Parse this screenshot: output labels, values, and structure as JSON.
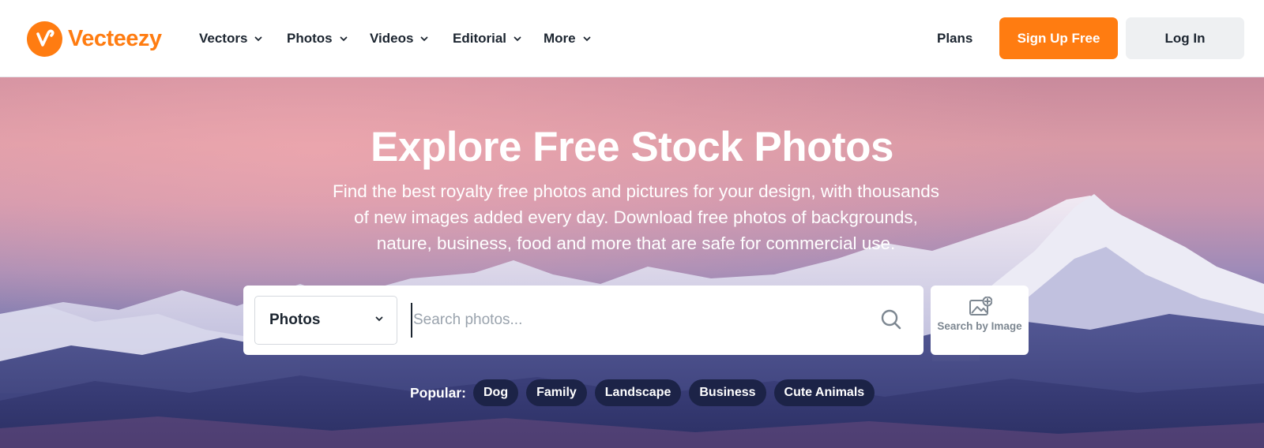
{
  "brand": {
    "name": "Vecteezy",
    "color": "#ff7c11"
  },
  "nav": {
    "items": [
      {
        "label": "Vectors"
      },
      {
        "label": "Photos"
      },
      {
        "label": "Videos"
      },
      {
        "label": "Editorial"
      },
      {
        "label": "More"
      }
    ],
    "plans_label": "Plans",
    "signup_label": "Sign Up Free",
    "login_label": "Log In"
  },
  "hero": {
    "title": "Explore Free Stock Photos",
    "description": "Find the best royalty free photos and pictures for your design, with thousands of new images added every day. Download free photos of backgrounds, nature, business, food and more that are safe for commercial use."
  },
  "search": {
    "category_value": "Photos",
    "placeholder": "Search photos...",
    "value": "",
    "image_search_label": "Search by Image"
  },
  "popular": {
    "label": "Popular:",
    "tags": [
      "Dog",
      "Family",
      "Landscape",
      "Business",
      "Cute Animals"
    ]
  },
  "icons": {
    "logo": "vecteezy-logo-icon",
    "nav_chevron": "chevron-down-icon",
    "search": "search-icon",
    "image_search": "image-plus-icon"
  }
}
